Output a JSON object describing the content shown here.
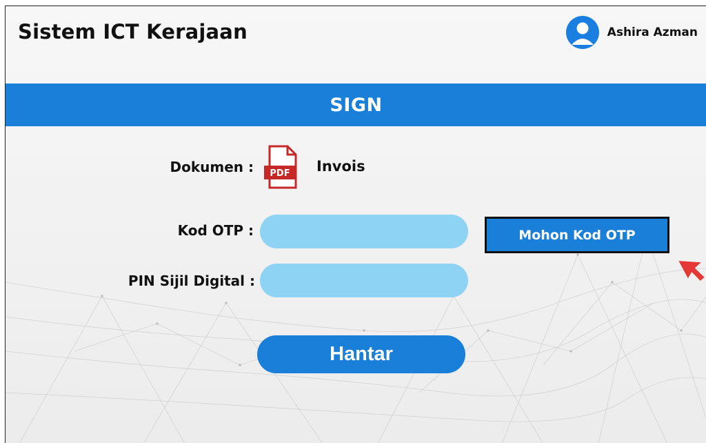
{
  "app": {
    "title": "Sistem ICT Kerajaan"
  },
  "user": {
    "name": "Ashira Azman"
  },
  "banner": {
    "title": "SIGN"
  },
  "document": {
    "label": "Dokumen :",
    "icon_text": "PDF",
    "name": "Invois"
  },
  "form": {
    "otp_label": "Kod OTP :",
    "otp_value": "",
    "pin_label": "PIN Sijil Digital :",
    "pin_value": "",
    "request_otp_button": "Mohon Kod OTP",
    "submit_button": "Hantar"
  },
  "colors": {
    "accent": "#1a7fd9",
    "field": "#8fd3f4",
    "pdf_red": "#c62828",
    "cursor_red": "#e53935"
  },
  "icons": {
    "avatar": "user-avatar-icon",
    "document": "pdf-file-icon",
    "cursor": "mouse-pointer-icon"
  }
}
